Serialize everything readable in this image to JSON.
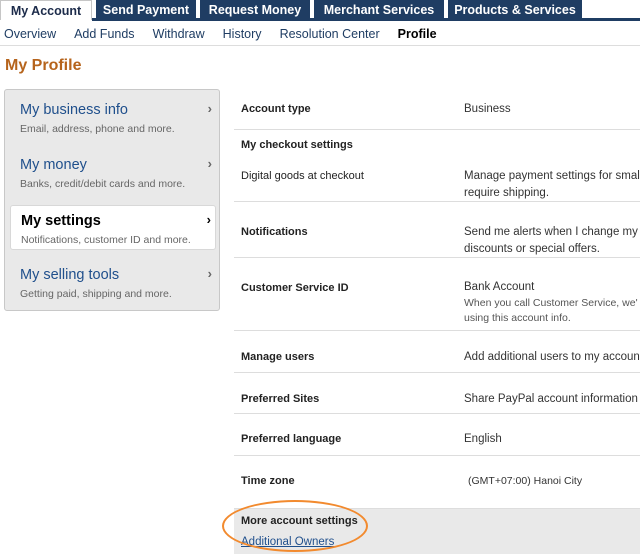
{
  "top_tabs": [
    {
      "label": "My Account"
    },
    {
      "label": "Send Payment"
    },
    {
      "label": "Request Money"
    },
    {
      "label": "Merchant Services"
    },
    {
      "label": "Products & Services"
    }
  ],
  "subnav": [
    {
      "label": "Overview"
    },
    {
      "label": "Add Funds"
    },
    {
      "label": "Withdraw"
    },
    {
      "label": "History"
    },
    {
      "label": "Resolution Center"
    },
    {
      "label": "Profile"
    }
  ],
  "page_title": "My Profile",
  "sidebar": {
    "items": [
      {
        "title": "My business info",
        "subtitle": "Email, address, phone and more."
      },
      {
        "title": "My money",
        "subtitle": "Banks, credit/debit cards and more."
      },
      {
        "title": "My settings",
        "subtitle": "Notifications, customer ID and more."
      },
      {
        "title": "My selling tools",
        "subtitle": "Getting paid, shipping and more."
      }
    ],
    "chevron": "›"
  },
  "settings": {
    "account_type": {
      "label": "Account type",
      "value": "Business"
    },
    "checkout_header": "My checkout settings",
    "digital_goods": {
      "label": "Digital goods at checkout",
      "value_line1": "Manage payment settings for small",
      "value_line2": "require shipping."
    },
    "notifications": {
      "label": "Notifications",
      "value_line1": "Send me alerts when I change my a",
      "value_line2": "discounts or special offers."
    },
    "customer_service": {
      "label": "Customer Service ID",
      "value": "Bank Account",
      "sub_line1": "When you call Customer Service, we'",
      "sub_line2": "using this account info."
    },
    "manage_users": {
      "label": "Manage users",
      "value": "Add additional users to my accoun"
    },
    "preferred_sites": {
      "label": "Preferred Sites",
      "value": "Share PayPal account information"
    },
    "preferred_language": {
      "label": "Preferred language",
      "value": "English"
    },
    "time_zone": {
      "label": "Time zone",
      "value": "(GMT+07:00) Hanoi City"
    }
  },
  "more": {
    "title": "More account settings",
    "link": "Additional Owners"
  },
  "colors": {
    "nav_dark": "#1f3d63",
    "title_orange": "#b6641c",
    "link_blue": "#1f4f8c",
    "highlight_orange": "#f28a2e"
  }
}
